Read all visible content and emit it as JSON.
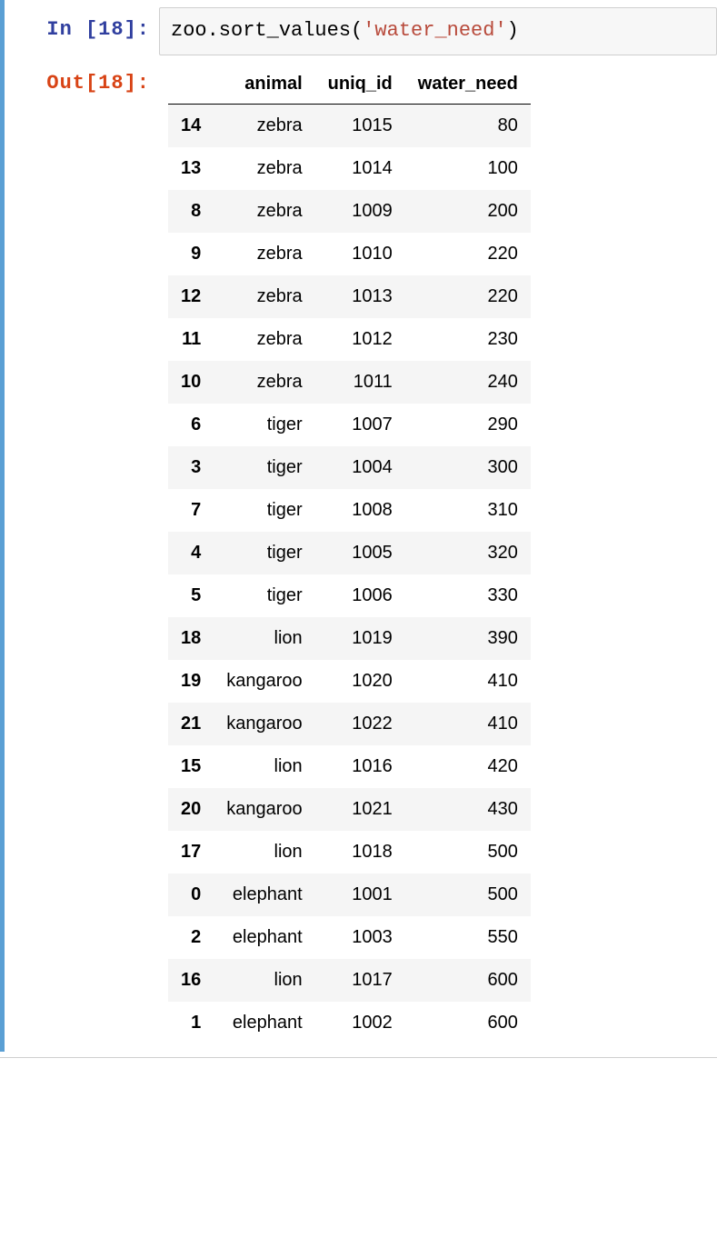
{
  "cell": {
    "in_prompt": "In [18]:",
    "out_prompt": "Out[18]:",
    "code_prefix": "zoo.sort_values(",
    "code_string": "'water_need'",
    "code_suffix": ")"
  },
  "table": {
    "columns": [
      "animal",
      "uniq_id",
      "water_need"
    ],
    "rows": [
      {
        "index": "14",
        "animal": "zebra",
        "uniq_id": "1015",
        "water_need": "80"
      },
      {
        "index": "13",
        "animal": "zebra",
        "uniq_id": "1014",
        "water_need": "100"
      },
      {
        "index": "8",
        "animal": "zebra",
        "uniq_id": "1009",
        "water_need": "200"
      },
      {
        "index": "9",
        "animal": "zebra",
        "uniq_id": "1010",
        "water_need": "220"
      },
      {
        "index": "12",
        "animal": "zebra",
        "uniq_id": "1013",
        "water_need": "220"
      },
      {
        "index": "11",
        "animal": "zebra",
        "uniq_id": "1012",
        "water_need": "230"
      },
      {
        "index": "10",
        "animal": "zebra",
        "uniq_id": "1011",
        "water_need": "240"
      },
      {
        "index": "6",
        "animal": "tiger",
        "uniq_id": "1007",
        "water_need": "290"
      },
      {
        "index": "3",
        "animal": "tiger",
        "uniq_id": "1004",
        "water_need": "300"
      },
      {
        "index": "7",
        "animal": "tiger",
        "uniq_id": "1008",
        "water_need": "310"
      },
      {
        "index": "4",
        "animal": "tiger",
        "uniq_id": "1005",
        "water_need": "320"
      },
      {
        "index": "5",
        "animal": "tiger",
        "uniq_id": "1006",
        "water_need": "330"
      },
      {
        "index": "18",
        "animal": "lion",
        "uniq_id": "1019",
        "water_need": "390"
      },
      {
        "index": "19",
        "animal": "kangaroo",
        "uniq_id": "1020",
        "water_need": "410"
      },
      {
        "index": "21",
        "animal": "kangaroo",
        "uniq_id": "1022",
        "water_need": "410"
      },
      {
        "index": "15",
        "animal": "lion",
        "uniq_id": "1016",
        "water_need": "420"
      },
      {
        "index": "20",
        "animal": "kangaroo",
        "uniq_id": "1021",
        "water_need": "430"
      },
      {
        "index": "17",
        "animal": "lion",
        "uniq_id": "1018",
        "water_need": "500"
      },
      {
        "index": "0",
        "animal": "elephant",
        "uniq_id": "1001",
        "water_need": "500"
      },
      {
        "index": "2",
        "animal": "elephant",
        "uniq_id": "1003",
        "water_need": "550"
      },
      {
        "index": "16",
        "animal": "lion",
        "uniq_id": "1017",
        "water_need": "600"
      },
      {
        "index": "1",
        "animal": "elephant",
        "uniq_id": "1002",
        "water_need": "600"
      }
    ]
  }
}
